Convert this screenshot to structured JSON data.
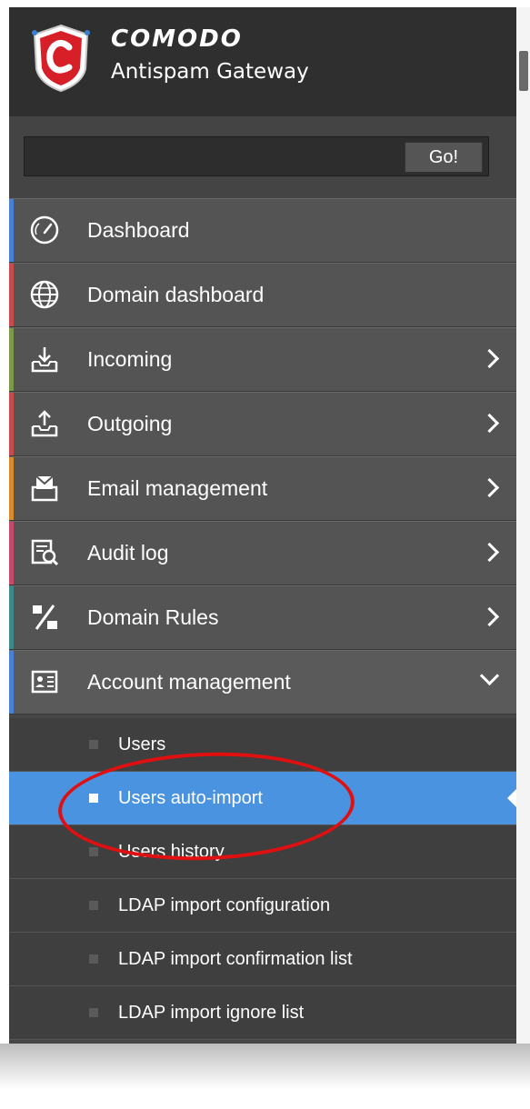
{
  "header": {
    "brand": "COMODO",
    "product": "Antispam Gateway"
  },
  "search": {
    "value": "",
    "placeholder": "",
    "go_label": "Go!"
  },
  "menu": [
    {
      "label": "Dashboard",
      "icon": "gauge-icon",
      "accent": "#4a7fd6",
      "has_children": false
    },
    {
      "label": "Domain dashboard",
      "icon": "globe-icon",
      "accent": "#c84a4a",
      "has_children": false
    },
    {
      "label": "Incoming",
      "icon": "inbox-download-icon",
      "accent": "#7a9a4a",
      "has_children": true
    },
    {
      "label": "Outgoing",
      "icon": "outbox-upload-icon",
      "accent": "#c84a4a",
      "has_children": true
    },
    {
      "label": "Email management",
      "icon": "envelope-tray-icon",
      "accent": "#d98a2a",
      "has_children": true
    },
    {
      "label": "Audit log",
      "icon": "audit-search-icon",
      "accent": "#c84a6a",
      "has_children": true
    },
    {
      "label": "Domain Rules",
      "icon": "percent-rules-icon",
      "accent": "#3a8a8a",
      "has_children": true
    },
    {
      "label": "Account management",
      "icon": "account-card-icon",
      "accent": "#4a7fd6",
      "has_children": true,
      "expanded": true
    }
  ],
  "submenu": [
    {
      "label": "Users",
      "active": false
    },
    {
      "label": "Users auto-import",
      "active": true
    },
    {
      "label": "Users history",
      "active": false
    },
    {
      "label": "LDAP import configuration",
      "active": false
    },
    {
      "label": "LDAP import confirmation list",
      "active": false
    },
    {
      "label": "LDAP import ignore list",
      "active": false
    }
  ],
  "colors": {
    "sidebar_bg": "#464646",
    "menu_item_bg": "#545454",
    "active_bg": "#4a93e0",
    "highlight": "#e01010"
  }
}
